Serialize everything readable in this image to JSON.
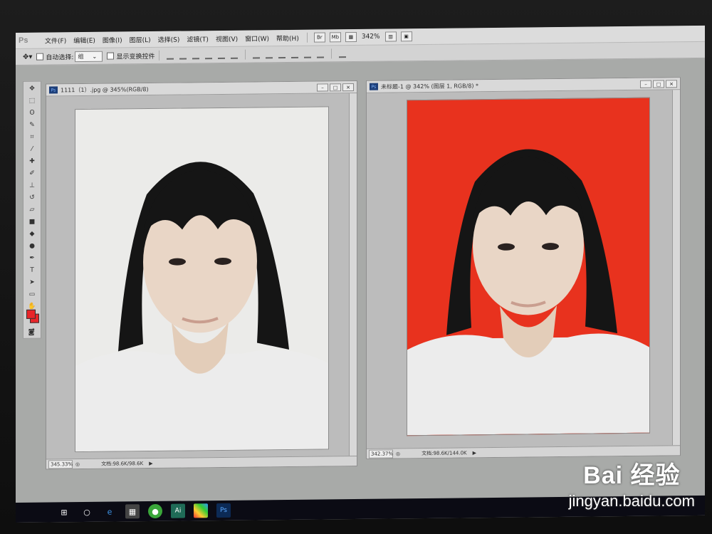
{
  "menubar": {
    "app_logo": "Ps",
    "items": [
      "文件(F)",
      "编辑(E)",
      "图像(I)",
      "图层(L)",
      "选择(S)",
      "滤镜(T)",
      "视图(V)",
      "窗口(W)",
      "帮助(H)"
    ],
    "zoom": "342%"
  },
  "optbar": {
    "auto_select": "自动选择:",
    "auto_select_value": "组",
    "show_transform": "显示变换控件"
  },
  "doc1": {
    "title": "1111（1）.jpg @ 345%(RGB/8)",
    "badge": "Ps",
    "zoom": "345.33%",
    "docsize": "文档:98.6K/98.6K"
  },
  "doc2": {
    "title": "未标题-1 @ 342% (图层 1, RGB/8) *",
    "badge": "Ps",
    "zoom": "342.37%",
    "docsize": "文档:98.6K/144.0K"
  },
  "colors": {
    "foreground": "#e8262a",
    "background": "#e8262a",
    "photo2_bg": "#e8321e",
    "photo1_bg": "#ebebe9"
  },
  "watermark": {
    "line1": "Bai 经验",
    "line2": "jingyan.baidu.com"
  },
  "icons": {
    "taskbar": [
      "windows-start-icon",
      "cortana-icon",
      "edge-icon",
      "calculator-icon",
      "app-green-icon",
      "app-ai-icon",
      "app-colorful-icon",
      "photoshop-icon"
    ]
  }
}
